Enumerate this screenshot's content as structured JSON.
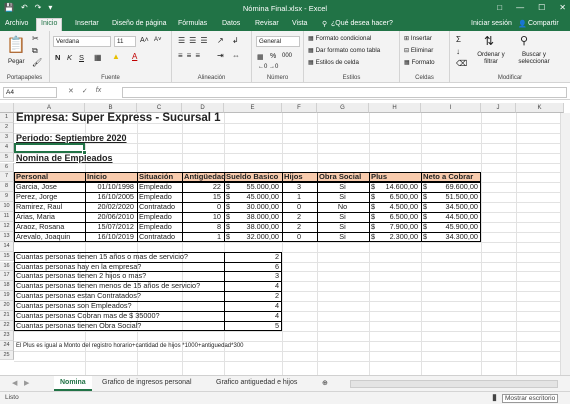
{
  "window": {
    "title": "Nómina Final.xlsx - Excel",
    "qat": [
      "save-icon",
      "undo-icon",
      "redo-icon",
      "customize-icon"
    ]
  },
  "tabs": {
    "file": "Archivo",
    "items": [
      "Inicio",
      "Insertar",
      "Diseño de página",
      "Fórmulas",
      "Datos",
      "Revisar",
      "Vista"
    ],
    "active": "Inicio",
    "tellme": "¿Qué desea hacer?",
    "signin": "Iniciar sesión",
    "share": "Compartir"
  },
  "ribbon": {
    "clipboard": {
      "label": "Portapapeles",
      "paste": "Pegar"
    },
    "font": {
      "label": "Fuente",
      "name": "Verdana",
      "size": "11",
      "bold": "N",
      "italic": "K",
      "underline": "S"
    },
    "alignment": {
      "label": "Alineación"
    },
    "number": {
      "label": "Número",
      "format": "General",
      "percent": "%",
      "thousands": "000"
    },
    "styles": {
      "label": "Estilos",
      "conditional": "Formato condicional",
      "table": "Dar formato como tabla",
      "cell": "Estilos de celda"
    },
    "cells": {
      "label": "Celdas",
      "insert": "Insertar",
      "delete": "Eliminar",
      "format": "Formato"
    },
    "editing": {
      "label": "Modificar",
      "sort": "Ordenar y filtrar",
      "find": "Buscar y seleccionar"
    }
  },
  "formula_bar": {
    "name_box": "A4",
    "formula": ""
  },
  "columns": [
    "A",
    "B",
    "C",
    "D",
    "E",
    "F",
    "G",
    "H",
    "I",
    "J",
    "K"
  ],
  "rows": [
    "1",
    "2",
    "3",
    "4",
    "5",
    "6",
    "7",
    "8",
    "9",
    "10",
    "11",
    "12",
    "13",
    "14",
    "15",
    "16",
    "17",
    "18",
    "19",
    "20",
    "21",
    "22",
    "23",
    "24",
    "25"
  ],
  "sheet": {
    "title": "Empresa:  Super Express - Sucursal 1",
    "period": "Periodo: Septiembre 2020",
    "subtitle": "Nomina de Empleados",
    "headers": [
      "Personal",
      "Inicio",
      "Situación",
      "Antigüedad",
      "Sueldo Basico",
      "Hijos",
      "Obra Social",
      "Plus",
      "Neto a Cobrar"
    ],
    "employees": [
      [
        "Garcia, Jose",
        "01/10/1998",
        "Empleado",
        "22",
        "$",
        "55.000,00",
        "3",
        "Si",
        "$",
        "14.600,00",
        "$",
        "69.600,00"
      ],
      [
        "Perez, Jorge",
        "16/10/2005",
        "Empleado",
        "15",
        "$",
        "45.000,00",
        "1",
        "Si",
        "$",
        "6.500,00",
        "$",
        "51.500,00"
      ],
      [
        "Ramirez, Raul",
        "20/02/2020",
        "Contratado",
        "0",
        "$",
        "30.000,00",
        "0",
        "No",
        "$",
        "4.500,00",
        "$",
        "34.500,00"
      ],
      [
        "Arias, Maria",
        "20/06/2010",
        "Empleado",
        "10",
        "$",
        "38.000,00",
        "2",
        "Si",
        "$",
        "6.500,00",
        "$",
        "44.500,00"
      ],
      [
        "Araoz, Rosana",
        "15/07/2012",
        "Empleado",
        "8",
        "$",
        "38.000,00",
        "2",
        "Si",
        "$",
        "7.900,00",
        "$",
        "45.900,00"
      ],
      [
        "Arevalo, Joaquin",
        "16/10/2019",
        "Contratado",
        "1",
        "$",
        "32.000,00",
        "0",
        "Si",
        "$",
        "2.300,00",
        "$",
        "34.300,00"
      ]
    ],
    "questions": [
      {
        "q": "Cuantas personas tienen 15 años o mas de servicio?",
        "a": "2"
      },
      {
        "q": "Cuantas personas hay en la empresa?",
        "a": "6"
      },
      {
        "q": "Cuantas personas tienen 2 hijos o mas?",
        "a": "3"
      },
      {
        "q": "Cuantas personas tienen menos de 15 años de servicio?",
        "a": "4"
      },
      {
        "q": "Cuantas personas estan Contratados?",
        "a": "2"
      },
      {
        "q": "Cuantas personas son Empleados?",
        "a": "4"
      },
      {
        "q": "Cuantas personas Cobran mas de $ 35000?",
        "a": "4"
      },
      {
        "q": "Cuantas personas tienen Obra Social?",
        "a": "5"
      }
    ],
    "note": "El Plus es igual a Monto del registro horario+cantidad de hijos *1000+antiguedad*300"
  },
  "sheet_tabs": [
    "Nomina",
    "Grafico de ingresos personal",
    "Grafico antiguedad e hijos"
  ],
  "active_sheet": "Nomina",
  "status": {
    "ready": "Listo",
    "mode": "Mostrar escritorio"
  },
  "colors": {
    "brand": "#217346",
    "header_fill": "#f8cbad",
    "border": "#000000"
  }
}
